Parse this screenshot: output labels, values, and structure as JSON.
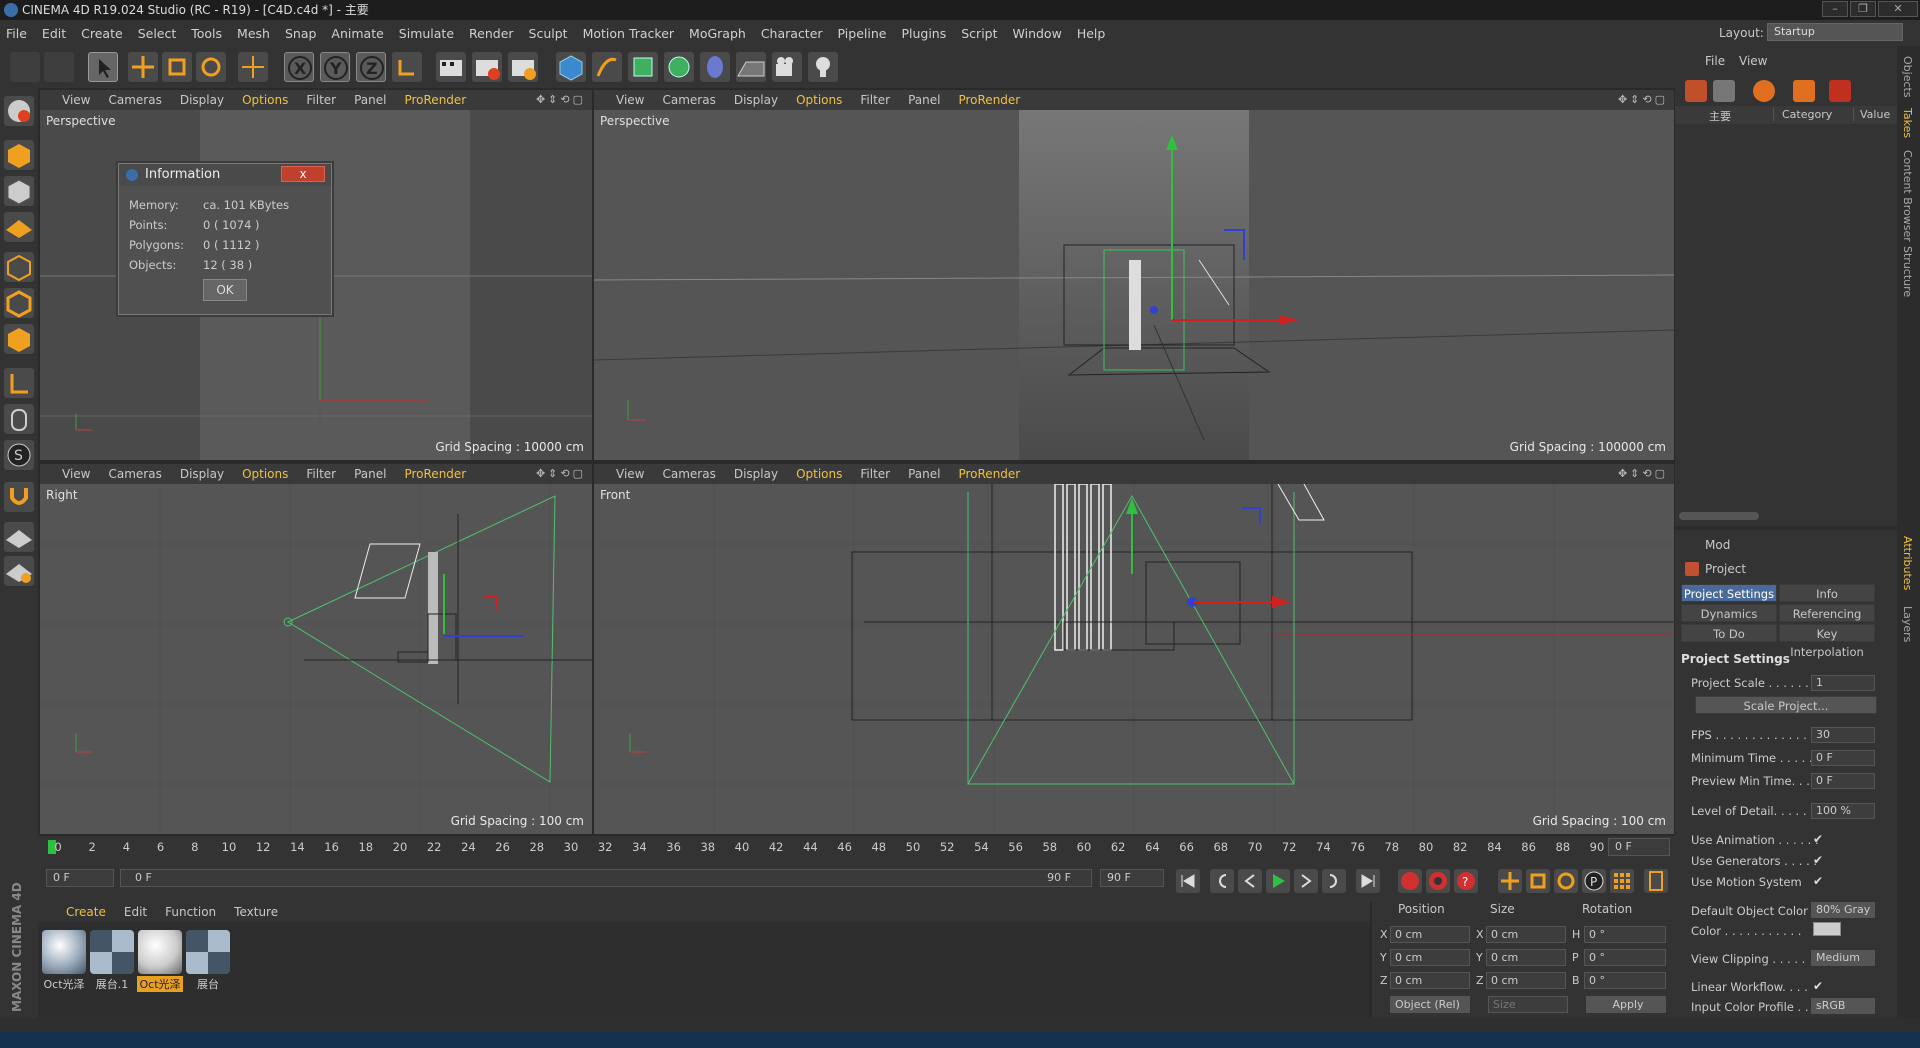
{
  "window": {
    "title": "CINEMA 4D R19.024 Studio (RC - R19) - [C4D.c4d *] - 主要"
  },
  "menu": [
    "File",
    "Edit",
    "Create",
    "Select",
    "Tools",
    "Mesh",
    "Snap",
    "Animate",
    "Simulate",
    "Render",
    "Sculpt",
    "Motion Tracker",
    "MoGraph",
    "Character",
    "Pipeline",
    "Plugins",
    "Script",
    "Window",
    "Help"
  ],
  "layout": {
    "label": "Layout:",
    "value": "Startup"
  },
  "viewport_menu": {
    "view": "View",
    "cameras": "Cameras",
    "display": "Display",
    "options": "Options",
    "filter": "Filter",
    "panel": "Panel",
    "prorender": "ProRender"
  },
  "viewports": {
    "tl": {
      "name": "Perspective",
      "grid": "Grid Spacing : 10000 cm"
    },
    "tr": {
      "name": "Perspective",
      "grid": "Grid Spacing : 100000 cm"
    },
    "bl": {
      "name": "Right",
      "grid": "Grid Spacing : 100 cm"
    },
    "br": {
      "name": "Front",
      "grid": "Grid Spacing : 100 cm"
    }
  },
  "info_dialog": {
    "title": "Information",
    "close": "x",
    "rows": [
      {
        "label": "Memory:",
        "value": "ca. 101 KBytes"
      },
      {
        "label": "Points:",
        "value": "0 ( 1074 )"
      },
      {
        "label": "Polygons:",
        "value": "0 ( 1112 )"
      },
      {
        "label": "Objects:",
        "value": "12 ( 38 )"
      }
    ],
    "ok": "OK"
  },
  "timeline": {
    "ticks": [
      "0",
      "2",
      "4",
      "6",
      "8",
      "10",
      "12",
      "14",
      "16",
      "18",
      "20",
      "22",
      "24",
      "26",
      "28",
      "30",
      "32",
      "34",
      "36",
      "38",
      "40",
      "42",
      "44",
      "46",
      "48",
      "50",
      "52",
      "54",
      "56",
      "58",
      "60",
      "62",
      "64",
      "66",
      "68",
      "70",
      "72",
      "74",
      "76",
      "78",
      "80",
      "82",
      "84",
      "86",
      "88",
      "90"
    ],
    "current": "0 F",
    "start": "0 F",
    "range_start": "0 F",
    "range_end": "90 F",
    "end": "90 F"
  },
  "materials": {
    "menu": [
      "Create",
      "Edit",
      "Function",
      "Texture"
    ],
    "items": [
      {
        "label": "Oct光泽",
        "selected": false
      },
      {
        "label": "展台.1",
        "selected": false
      },
      {
        "label": "Oct光泽",
        "selected": true
      },
      {
        "label": "展台",
        "selected": false
      }
    ]
  },
  "coordinates": {
    "headers": [
      "Position",
      "Size",
      "Rotation"
    ],
    "rows": [
      {
        "axis": "X",
        "pos": "0 cm",
        "saxis": "X",
        "size": "0 cm",
        "raxis": "H",
        "rot": "0 °"
      },
      {
        "axis": "Y",
        "pos": "0 cm",
        "saxis": "Y",
        "size": "0 cm",
        "raxis": "P",
        "rot": "0 °"
      },
      {
        "axis": "Z",
        "pos": "0 cm",
        "saxis": "Z",
        "size": "0 cm",
        "raxis": "B",
        "rot": "0 °"
      }
    ],
    "mode": "Object (Rel)",
    "size_mode": "Size",
    "apply": "Apply"
  },
  "object_manager": {
    "menu": [
      "File",
      "View"
    ],
    "columns": {
      "name": "主要",
      "category": "Category",
      "value": "Value"
    }
  },
  "side_tabs": [
    "Objects",
    "Takes",
    "Content Browser",
    "Structure",
    "Attributes",
    "Layers"
  ],
  "attributes": {
    "mode": "Mod",
    "object": "Project",
    "tabs": [
      [
        "Project Settings",
        "Info"
      ],
      [
        "Dynamics",
        "Referencing"
      ],
      [
        "To Do",
        "Key Interpolation"
      ]
    ],
    "section": "Project Settings",
    "fields": [
      {
        "label": "Project Scale . . . . . . .",
        "value": "1"
      },
      {
        "label": "FPS . . . . . . . . . . . . . . .",
        "value": "30"
      },
      {
        "label": "Minimum Time . . . . .",
        "value": "0 F"
      },
      {
        "label": "Preview Min Time. . .",
        "value": "0 F"
      },
      {
        "label": "Level of Detail. . . . .",
        "value": "100 %"
      },
      {
        "label": "Use Animation . . . . . .",
        "check": "✔"
      },
      {
        "label": "Use Generators . . . . .",
        "check": "✔"
      },
      {
        "label": "Use Motion System",
        "check": "✔"
      },
      {
        "label": "Default Object Color",
        "value": "80% Gray"
      },
      {
        "label": "Color . . . . . . . . . . .",
        "value": ""
      },
      {
        "label": "View Clipping . . . . .",
        "value": "Medium"
      },
      {
        "label": "Linear Workflow. . . .",
        "check": "✔"
      },
      {
        "label": "Input Color Profile . .",
        "value": "sRGB"
      }
    ],
    "scale_button": "Scale Project..."
  },
  "maxon": "MAXON CINEMA 4D"
}
